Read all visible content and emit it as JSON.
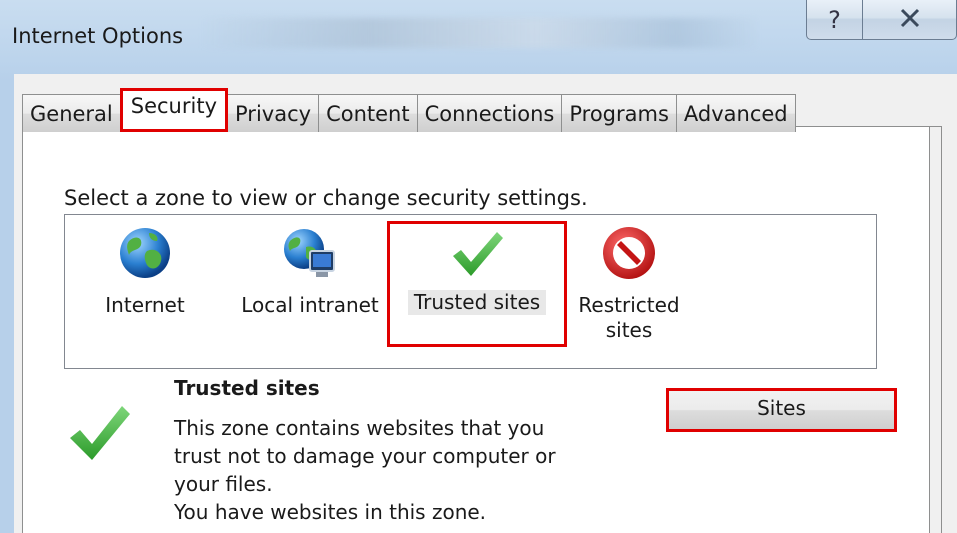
{
  "window": {
    "title": "Internet Options",
    "help_glyph": "?",
    "close_glyph": "X"
  },
  "tabs": [
    {
      "label": "General"
    },
    {
      "label": "Security"
    },
    {
      "label": "Privacy"
    },
    {
      "label": "Content"
    },
    {
      "label": "Connections"
    },
    {
      "label": "Programs"
    },
    {
      "label": "Advanced"
    }
  ],
  "active_tab": "Security",
  "security": {
    "select_zone_text": "Select a zone to view or change security settings.",
    "zones": [
      {
        "label": "Internet",
        "icon": "globe-icon"
      },
      {
        "label": "Local intranet",
        "icon": "intranet-globe-icon"
      },
      {
        "label": "Trusted sites",
        "icon": "checkmark-icon"
      },
      {
        "label_line1": "Restricted",
        "label_line2": "sites",
        "icon": "restricted-icon"
      }
    ],
    "selected_zone": "Trusted sites",
    "detail": {
      "title": "Trusted sites",
      "description": "This zone contains websites that you trust not to damage your computer or your files.",
      "desc_line1": "This zone contains websites that you",
      "desc_line2": "trust not to damage your computer or",
      "desc_line3": "your files.",
      "status": "You have websites in this zone.",
      "sites_button": "Sites"
    }
  },
  "colors": {
    "highlight_border": "#e00000",
    "check_green": "#3ea83a",
    "restricted_red": "#d21a1a"
  }
}
